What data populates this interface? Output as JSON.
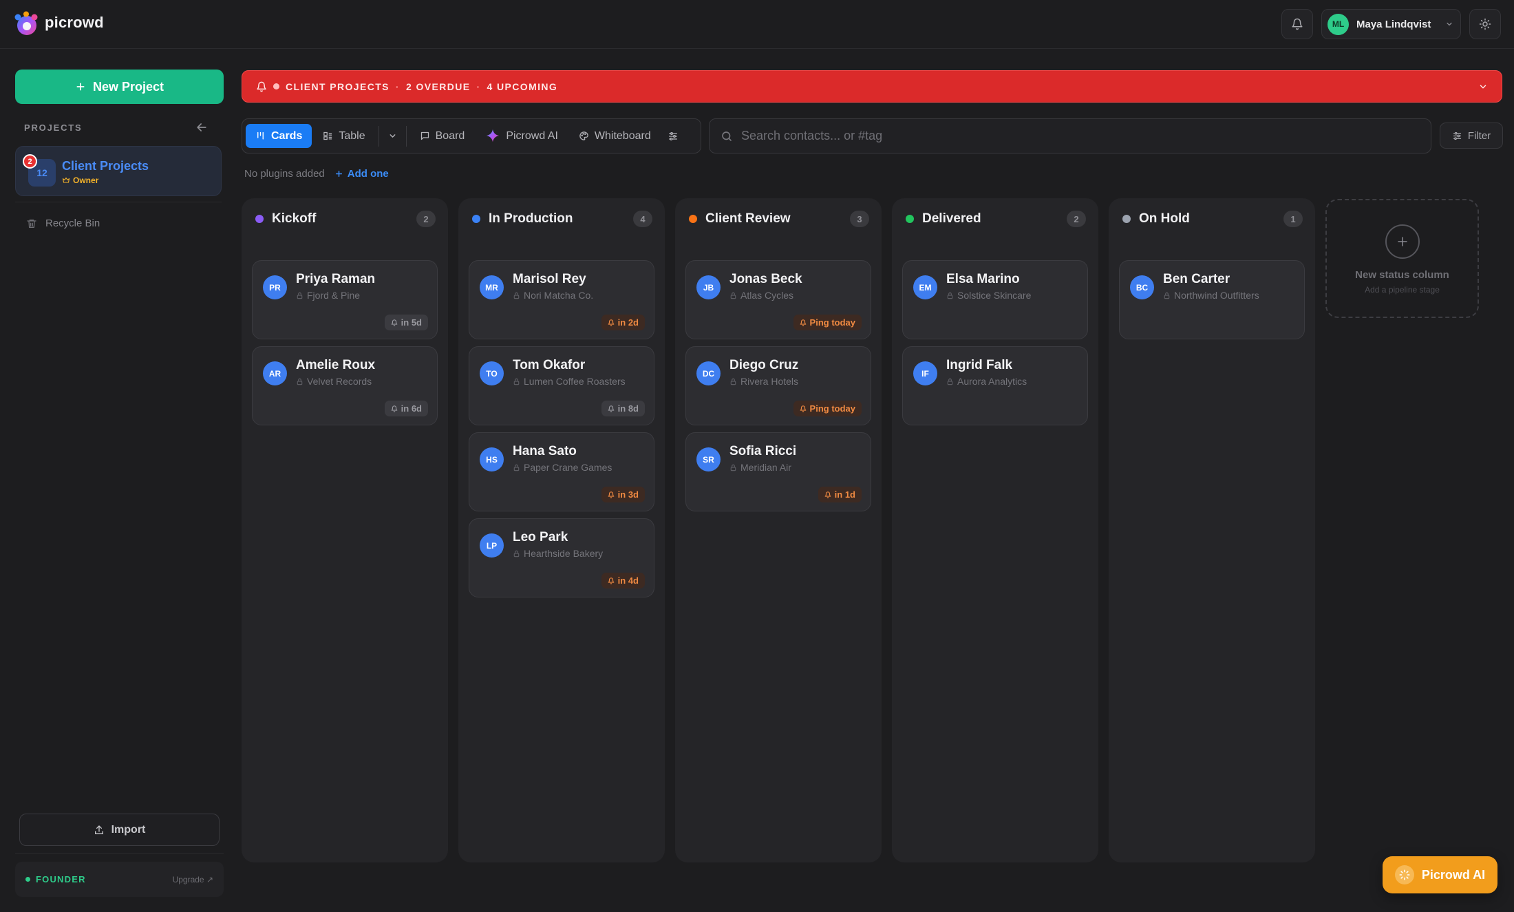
{
  "app": {
    "brand": "picrowd"
  },
  "header": {
    "user": {
      "initials": "ML",
      "name": "Maya Lindqvist",
      "avatar_color": "#2ecc8a"
    }
  },
  "sidebar": {
    "new_project_label": "New Project",
    "section_label": "PROJECTS",
    "project": {
      "icon_text": "12",
      "badge": "2",
      "name": "Client Projects",
      "role": "Owner"
    },
    "recycle_bin": "Recycle Bin",
    "import_label": "Import",
    "plan": {
      "label": "FOUNDER",
      "upgrade": "Upgrade ↗"
    }
  },
  "alert": {
    "project": "CLIENT PROJECTS",
    "sep": "·",
    "overdue": "2 OVERDUE",
    "upcoming": "4 UPCOMING"
  },
  "views": {
    "cards": "Cards",
    "table": "Table",
    "board": "Board",
    "ai": "Picrowd AI",
    "whiteboard": "Whiteboard"
  },
  "search": {
    "placeholder": "Search contacts... or #tag",
    "value": ""
  },
  "filter_label": "Filter",
  "plugins": {
    "empty_text": "No plugins added",
    "add_label": "Add one"
  },
  "columns": [
    {
      "title": "Kickoff",
      "count": "2",
      "color": "#8b5cf6",
      "cards": [
        {
          "initials": "PR",
          "name": "Priya Raman",
          "company": "Fjord & Pine",
          "due": "in 5d",
          "tone": "neutral"
        },
        {
          "initials": "AR",
          "name": "Amelie Roux",
          "company": "Velvet Records",
          "due": "in 6d",
          "tone": "neutral"
        }
      ]
    },
    {
      "title": "In Production",
      "count": "4",
      "color": "#3b82f6",
      "cards": [
        {
          "initials": "MR",
          "name": "Marisol Rey",
          "company": "Nori Matcha Co.",
          "due": "in 2d",
          "tone": "warn"
        },
        {
          "initials": "TO",
          "name": "Tom Okafor",
          "company": "Lumen Coffee Roasters",
          "due": "in 8d",
          "tone": "neutral"
        },
        {
          "initials": "HS",
          "name": "Hana Sato",
          "company": "Paper Crane Games",
          "due": "in 3d",
          "tone": "warn"
        },
        {
          "initials": "LP",
          "name": "Leo Park",
          "company": "Hearthside Bakery",
          "due": "in 4d",
          "tone": "warn"
        }
      ]
    },
    {
      "title": "Client Review",
      "count": "3",
      "color": "#f97316",
      "cards": [
        {
          "initials": "JB",
          "name": "Jonas Beck",
          "company": "Atlas Cycles",
          "due": "Ping today",
          "tone": "warn"
        },
        {
          "initials": "DC",
          "name": "Diego Cruz",
          "company": "Rivera Hotels",
          "due": "Ping today",
          "tone": "warn"
        },
        {
          "initials": "SR",
          "name": "Sofia Ricci",
          "company": "Meridian Air",
          "due": "in 1d",
          "tone": "warn"
        }
      ]
    },
    {
      "title": "Delivered",
      "count": "2",
      "color": "#22c55e",
      "cards": [
        {
          "initials": "EM",
          "name": "Elsa Marino",
          "company": "Solstice Skincare",
          "due": "",
          "tone": "none"
        },
        {
          "initials": "IF",
          "name": "Ingrid Falk",
          "company": "Aurora Analytics",
          "due": "",
          "tone": "none"
        }
      ]
    },
    {
      "title": "On Hold",
      "count": "1",
      "color": "#9ca3af",
      "cards": [
        {
          "initials": "BC",
          "name": "Ben Carter",
          "company": "Northwind Outfitters",
          "due": "",
          "tone": "none"
        }
      ]
    }
  ],
  "new_column": {
    "title": "New status column",
    "subtitle": "Add a pipeline stage"
  },
  "ai_fab_label": "Picrowd AI"
}
